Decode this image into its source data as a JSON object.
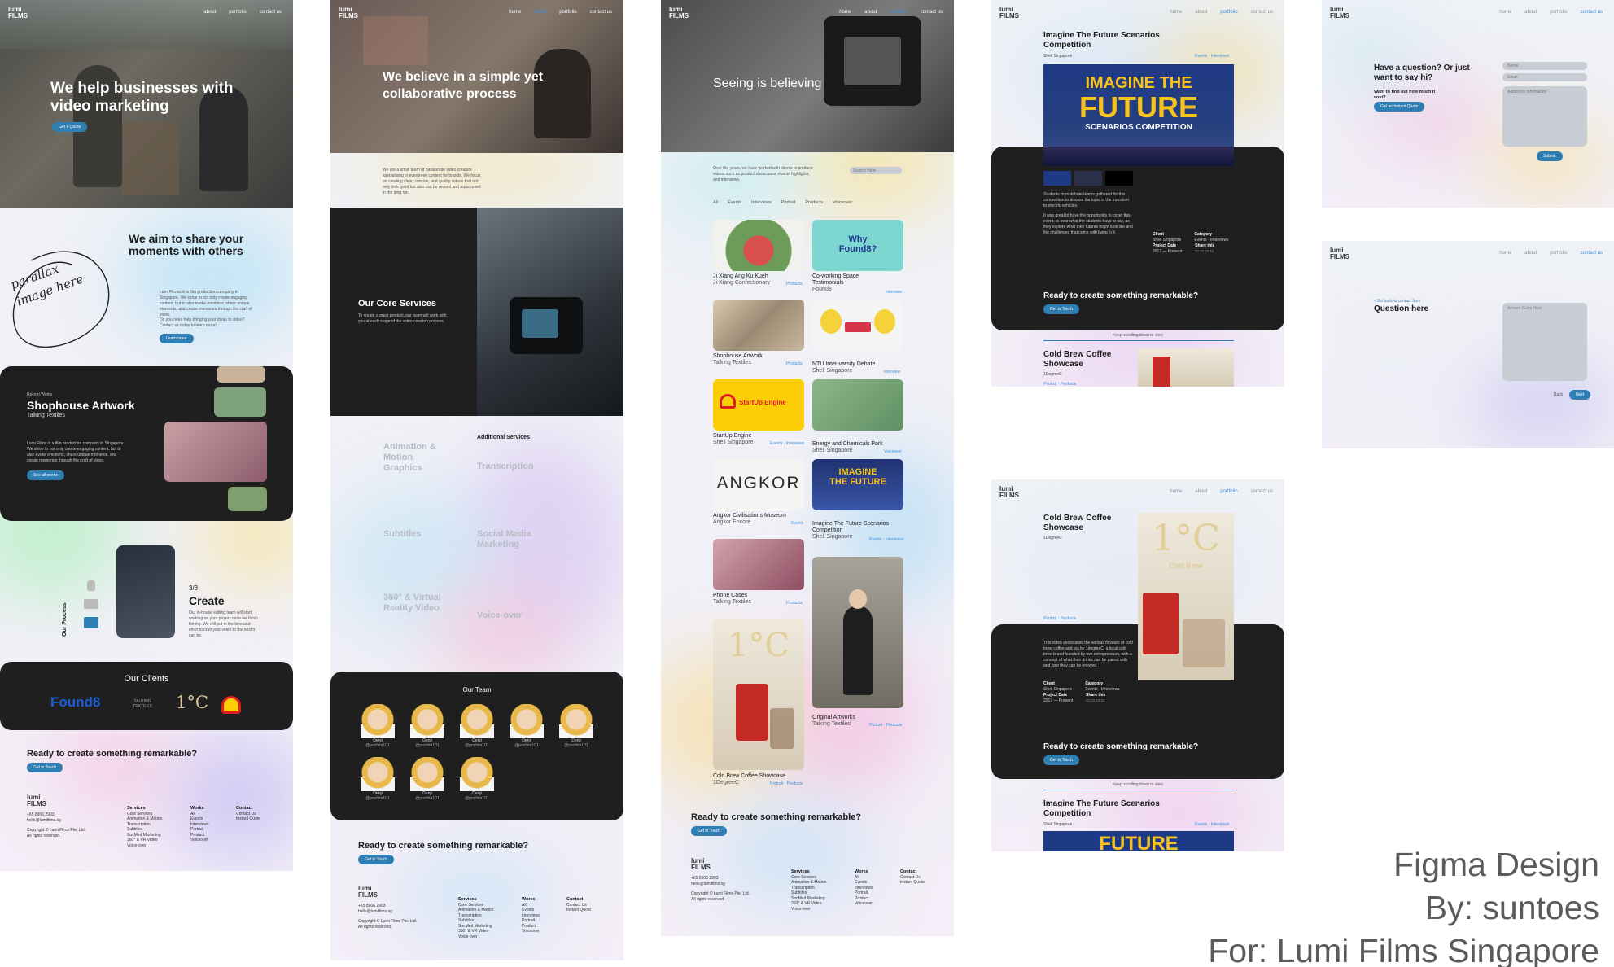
{
  "site": {
    "logo": "lumi\nFILMS"
  },
  "caption": {
    "line1": "Figma Design",
    "line2": "By: suntoes",
    "line3": "For: Lumi Films Singapore"
  },
  "home": {
    "nav": [
      "about",
      "portfolio",
      "contact us"
    ],
    "hero_title": "We help businesses with video marketing",
    "hero_button": "Get a Quote",
    "aim_title": "We aim to share your moments with others",
    "parallax_note": "parallax image here",
    "aim_text": "Lumi Filmss is a film production company in Singapore. We strive to not only create engaging content, but to also evoke emotions, share unique moments, and create memories through the craft of video.",
    "aim_question": "Do you need help bringing your ideas to video? Contact us today to learn more!",
    "aim_button": "Learn more",
    "recent_label": "Recent Works",
    "recent_title": "Shophouse Artwork",
    "recent_sub": "Talking Textiles",
    "recent_text": "Lumi Films is a film production company in Singapore. We strive to not only create engaging content, but to also evoke emotions, share unique moments, and create memories through the craft of video.",
    "recent_button": "See all works",
    "process_label": "Our Process",
    "process_step": "3/3",
    "process_title": "Create",
    "process_text": "Our in-house editing team will start working on your project once we finish filming. We will put in the time and effort to craft your video to the best it can be.",
    "clients_title": "Our Clients",
    "clients": [
      "Found8",
      "TALKING TEXTILES",
      "1°C",
      "Shell"
    ],
    "cta": "Ready to create something remarkable?",
    "cta_button": "Get in Touch"
  },
  "footer": {
    "phone": "+65 8906 2903",
    "email": "hello@lumifilms.sg",
    "copyright": "Copyright © Lumi Films Pte. Ltd.",
    "rights": "All rights reserved.",
    "services_head": "Services",
    "services": [
      "Core Services",
      "Animation & Motion",
      "Transcription",
      "Subtitles",
      "SocMed Marketing",
      "360° & VR Video",
      "Voice-over"
    ],
    "works_head": "Works",
    "works": [
      "All",
      "Events",
      "Interviews",
      "Portrait",
      "Product",
      "Voiceover"
    ],
    "contact_head": "Contact",
    "contact": [
      "Contact Us",
      "Instant Quote"
    ]
  },
  "about": {
    "nav": [
      "home",
      "about",
      "portfolio",
      "contact us"
    ],
    "hero_title": "We believe in a simple yet collaborative process",
    "intro": "We are a small team of passionate video creators specialising in evergreen content for brands. We focus on creating clear, concise, and quality videos that not only look good but also can be reused and repurposed in the long run.",
    "core_title": "Our Core Services",
    "core_text": "To create a great product, our team will work with you at each stage of the video creation process.",
    "additional_title": "Additional Services",
    "services": [
      "Animation & Motion Graphics",
      "Transcription",
      "Subtitles",
      "Social Media Marketing",
      "360° & Virtual Reality Video",
      "Voice-over"
    ],
    "team_title": "Our Team",
    "member_name": "Denji",
    "member_handle": "@pochita101",
    "cta": "Ready to create something remarkable?",
    "cta_button": "Get in Touch"
  },
  "portfolio": {
    "nav": [
      "home",
      "about",
      "portfolio",
      "contact us"
    ],
    "hero_title": "Seeing is believing",
    "intro": "Over the years, we have worked with clients to produce videos such as product showcases, events highlights, and interviews.",
    "search_placeholder": "Search Here",
    "filters": [
      "All",
      "Events",
      "Interviews",
      "Portrait",
      "Products",
      "Voiceover"
    ],
    "items": [
      {
        "title": "Ji Xiang Ang Ku Kueh",
        "client": "Ji Xiang Confectionary",
        "tag": "Products"
      },
      {
        "title": "Co-working Space Testimonials",
        "client": "Found8",
        "tag": "Interview"
      },
      {
        "title": "Shophouse Artwork",
        "client": "Talking Textiles",
        "tag": "Products"
      },
      {
        "title": "NTU Inter-varsity Debate",
        "client": "Shell Singapore",
        "tag": "Interview"
      },
      {
        "title": "StartUp Engine",
        "client": "Shell Singapore",
        "tag": "Events · Interviews"
      },
      {
        "title": "Energy and Chemicals Park",
        "client": "Shell Singapore",
        "tag": "Voiceover"
      },
      {
        "title": "Angkor Civilisations Museum",
        "client": "Angkor Encore",
        "tag": "Events"
      },
      {
        "title": "Imagine The Future Scenarios Competition",
        "client": "Shell Singapore",
        "tag": "Events · Interviews"
      },
      {
        "title": "Phone Cases",
        "client": "Talking Textiles",
        "tag": "Products"
      },
      {
        "title": "Original Artworks",
        "client": "Talking Textiles",
        "tag": "Portrait · Products"
      },
      {
        "title": "Cold Brew Coffee Showcase",
        "client": "1DegreeC",
        "tag": "Portrait · Products"
      }
    ],
    "thumb_text": {
      "found8": "Why Found8?",
      "shell": "StartUp Engine",
      "angkor": "ANGKOR",
      "imagine": "IMAGINE THE FUTURE",
      "coldbrew": "1°C"
    },
    "cta": "Ready to create something remarkable?",
    "cta_button": "Get in Touch"
  },
  "project1": {
    "nav": [
      "home",
      "about",
      "portfolio",
      "contact us"
    ],
    "title": "Imagine The Future Scenarios Competition",
    "client": "Shell Singapore",
    "tags": "Events · Interviews",
    "image_text": [
      "IMAGINE THE",
      "FUTURE",
      "SCENARIOS COMPETITION"
    ],
    "text1": "Students from debate teams gathered for this competition to discuss the topic of the transition to electric vehicles.",
    "text2": "It was great to have the opportunity to cover this event, to hear what the students have to say, as they explore what their futures might look like and the challenges that come with living in it.",
    "meta": {
      "client_label": "Client",
      "client": "Shell Singapore",
      "category_label": "Category",
      "category": "Events · Interviews",
      "date_label": "Project Date",
      "date": "2017 — Present",
      "share_label": "Share this"
    },
    "cta": "Ready to create something remarkable?",
    "cta_button": "Get in Touch",
    "scroll_hint": "Keep scrolling down to view",
    "next_title": "Cold Brew Coffee Showcase",
    "next_client": "1DegreeC",
    "next_tags": "Portrait · Products"
  },
  "project2": {
    "title": "Cold Brew Coffee Showcase",
    "client": "1DegreeC",
    "tags": "Portrait · Products",
    "image_text": [
      "1°C",
      "Cold Brew"
    ],
    "text": "This video showcases the various flavours of cold brew coffee and tea by 1degreeC, a local cold brew brand founded by two entrepreneurs, with a concept of what their drinks can be paired with and how they can be enjoyed.",
    "meta": {
      "client_label": "Client",
      "client": "Shell Singapore",
      "category_label": "Category",
      "category": "Events · Interviews",
      "date_label": "Project Date",
      "date": "2017 — Present",
      "share_label": "Share this"
    },
    "cta": "Ready to create something remarkable?",
    "cta_button": "Get in Touch",
    "scroll_hint": "Keep scrolling down to view",
    "next_title": "Imagine The Future Scenarios Competition",
    "next_client": "Shell Singapore",
    "next_tags": "Events · Interviews",
    "next_image": "FUTURE"
  },
  "contact": {
    "title": "Have a question? Or just want to say hi?",
    "sub": "Want to find out how much it cost?",
    "quote_button": "Get an Instant Quote",
    "name_placeholder": "Name",
    "email_placeholder": "Email",
    "info_placeholder": "Additional Information",
    "submit": "Submit"
  },
  "quote": {
    "back": "< Go back to contact form",
    "title": "Question here",
    "answer_placeholder": "Answer Goes Here",
    "back_button": "Back",
    "next_button": "Next"
  },
  "colors": {
    "accent": "#2f7fb5",
    "dark_card": "#1f1f1f",
    "found8": "#1d5fd9",
    "shell_red": "#dd1d21",
    "shell_yellow": "#fbce07",
    "imagine_navy": "#243a7a",
    "imagine_gold": "#f7c21a"
  }
}
